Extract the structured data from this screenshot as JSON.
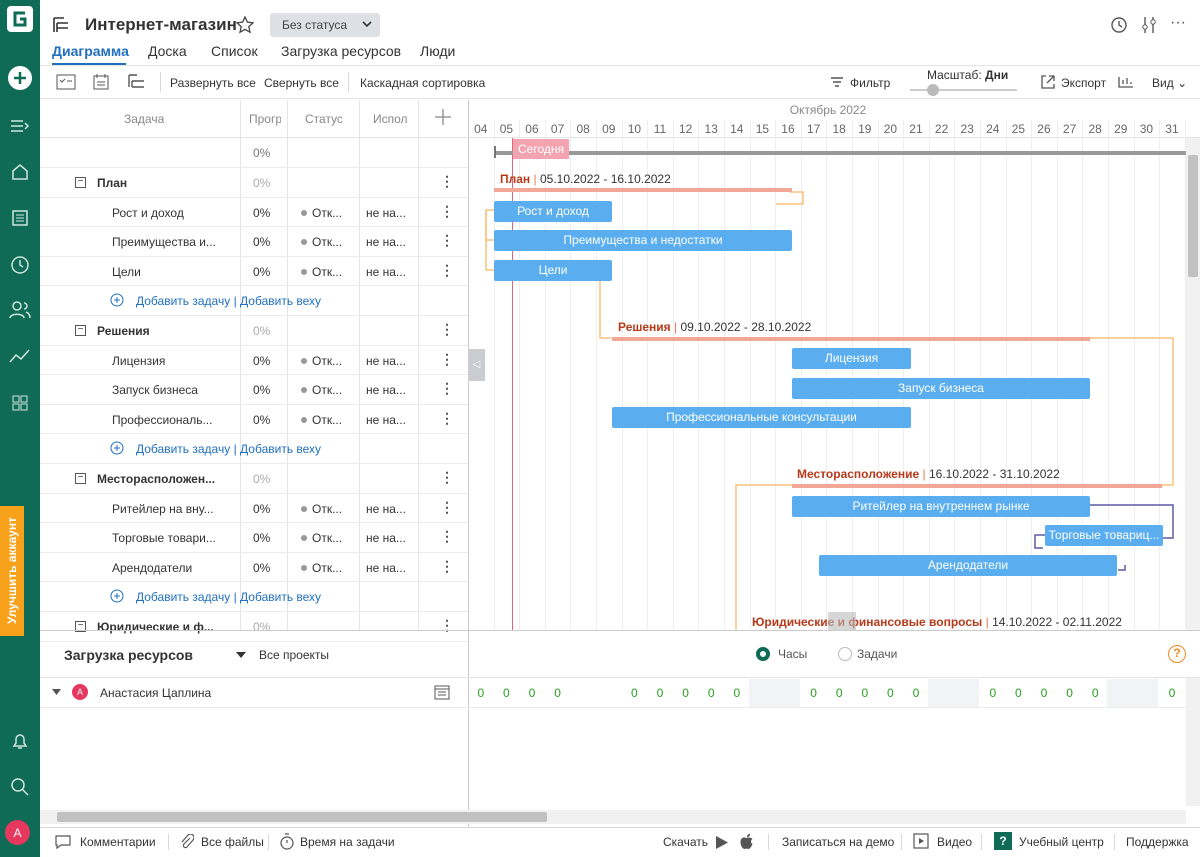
{
  "header": {
    "title": "Интернет-магазин",
    "status": "Без статуса"
  },
  "tabs": [
    {
      "label": "Диаграмма"
    },
    {
      "label": "Доска"
    },
    {
      "label": "Список"
    },
    {
      "label": "Загрузка ресурсов"
    },
    {
      "label": "Люди"
    }
  ],
  "toolbar": {
    "expand": "Развернуть все",
    "collapse": "Свернуть все",
    "cascade": "Каскадная сортировка",
    "filter": "Фильтр",
    "scale_label": "Масштаб:",
    "scale_value": "Дни",
    "export": "Экспорт",
    "view": "Вид"
  },
  "rail": {
    "upgrade": "Улучшить аккаунт",
    "avatar": "А"
  },
  "grid": {
    "columns": {
      "task": "Задача",
      "progress": "Прогр",
      "status": "Статус",
      "assignee": "Испол"
    },
    "top_row_progress": "0%",
    "rows": [
      {
        "type": "group",
        "name": "План",
        "progress": "0%"
      },
      {
        "type": "task",
        "name": "Рост и доход",
        "progress": "0%",
        "status": "Отк...",
        "assignee": "не на..."
      },
      {
        "type": "task",
        "name": "Преимущества и...",
        "progress": "0%",
        "status": "Отк...",
        "assignee": "не на..."
      },
      {
        "type": "task",
        "name": "Цели",
        "progress": "0%",
        "status": "Отк...",
        "assignee": "не на..."
      },
      {
        "type": "add"
      },
      {
        "type": "group",
        "name": "Решения",
        "progress": "0%"
      },
      {
        "type": "task",
        "name": "Лицензия",
        "progress": "0%",
        "status": "Отк...",
        "assignee": "не на..."
      },
      {
        "type": "task",
        "name": "Запуск бизнеса",
        "progress": "0%",
        "status": "Отк...",
        "assignee": "не на..."
      },
      {
        "type": "task",
        "name": "Профессиональ...",
        "progress": "0%",
        "status": "Отк...",
        "assignee": "не на..."
      },
      {
        "type": "add"
      },
      {
        "type": "group",
        "name": "Месторасположен...",
        "progress": "0%"
      },
      {
        "type": "task",
        "name": "Ритейлер на вну...",
        "progress": "0%",
        "status": "Отк...",
        "assignee": "не на..."
      },
      {
        "type": "task",
        "name": "Торговые товари...",
        "progress": "0%",
        "status": "Отк...",
        "assignee": "не на..."
      },
      {
        "type": "task",
        "name": "Арендодатели",
        "progress": "0%",
        "status": "Отк...",
        "assignee": "не на..."
      },
      {
        "type": "add"
      },
      {
        "type": "group",
        "name": "Юридические и ф...",
        "progress": "0%"
      }
    ],
    "add_task": "Добавить задачу",
    "add_milestone": "Добавить веху"
  },
  "gantt": {
    "month": "Октябрь 2022",
    "days": [
      "04",
      "05",
      "06",
      "07",
      "08",
      "09",
      "10",
      "11",
      "12",
      "13",
      "14",
      "15",
      "16",
      "17",
      "18",
      "19",
      "20",
      "21",
      "22",
      "23",
      "24",
      "25",
      "26",
      "27",
      "28",
      "29",
      "30",
      "31"
    ],
    "today_label": "Сегодня",
    "groups": [
      {
        "name": "План",
        "dates": "05.10.2022 - 16.10.2022"
      },
      {
        "name": "Решения",
        "dates": "09.10.2022 - 28.10.2022"
      },
      {
        "name": "Месторасположение",
        "dates": "16.10.2022 - 31.10.2022"
      },
      {
        "name": "Юридические и финансовые вопросы",
        "dates": "14.10.2022 - 02.11.2022"
      }
    ],
    "bars": [
      "Рост и доход",
      "Преимущества и недостатки",
      "Цели",
      "Лицензия",
      "Запуск бизнеса",
      "Профессиональные консультации",
      "Ритейлер на внутреннем рынке",
      "Торговые товариц...",
      "Арендодатели"
    ]
  },
  "resources": {
    "title": "Загрузка ресурсов",
    "filter": "Все проекты",
    "opt_hours": "Часы",
    "opt_tasks": "Задачи",
    "person": "Анастасия Цаплина",
    "avatar": "А",
    "values": [
      "0",
      "0",
      "0",
      "0",
      "0",
      "0",
      "0",
      "0",
      "0",
      "0",
      "0",
      "0",
      "0",
      "0",
      "0",
      "0",
      "0",
      "0",
      "0",
      "0",
      "0"
    ]
  },
  "footer": {
    "comments": "Комментарии",
    "files": "Все файлы",
    "time": "Время на задачи",
    "download": "Скачать",
    "demo": "Записаться на демо",
    "video": "Видео",
    "learning": "Учебный центр",
    "support": "Поддержка"
  },
  "colors": {
    "rail": "#0f6b56",
    "accent": "#1f6fbf",
    "bar": "#5aaef0",
    "group_line": "#f3a797",
    "upgrade": "#f7a11a"
  }
}
